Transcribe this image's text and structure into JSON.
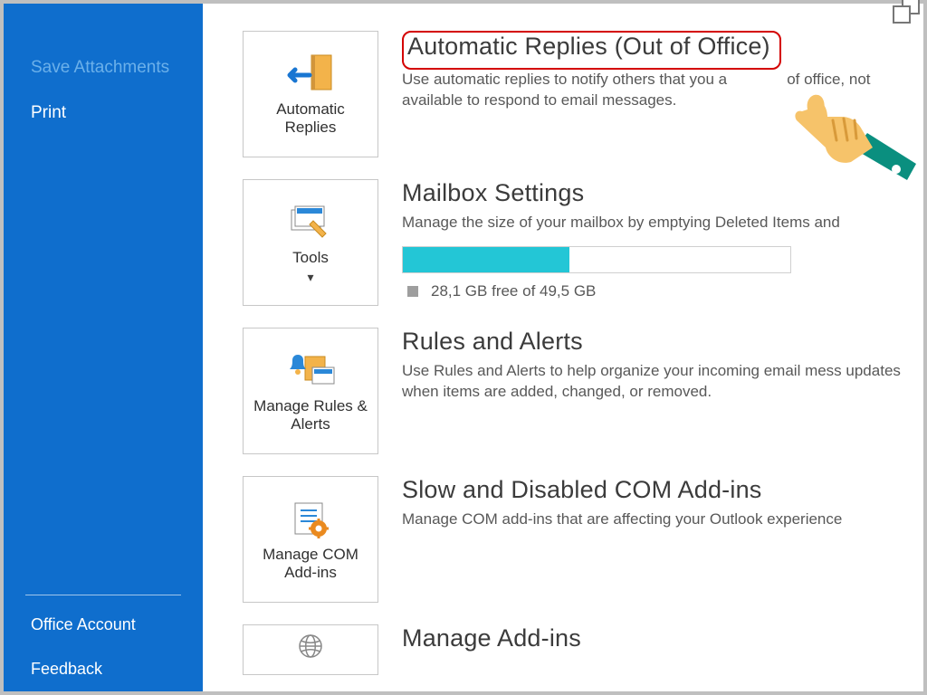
{
  "sidebar": {
    "save_attachments": "Save Attachments",
    "print": "Print",
    "office_account": "Office Account",
    "feedback": "Feedback"
  },
  "tiles": {
    "auto_replies": "Automatic Replies",
    "tools": "Tools",
    "rules": "Manage Rules & Alerts",
    "com": "Manage COM Add-ins"
  },
  "sections": {
    "auto": {
      "title": "Automatic Replies (Out of Office)",
      "desc_a": "Use automatic replies to notify others that you a",
      "desc_b": "of office, not available to respond to email messages."
    },
    "mailbox": {
      "title": "Mailbox Settings",
      "desc": "Manage the size of your mailbox by emptying Deleted Items and",
      "storage": "28,1 GB free of 49,5 GB",
      "fill_percent": 43
    },
    "rules": {
      "title": "Rules and Alerts",
      "desc": "Use Rules and Alerts to help organize your incoming email mess updates when items are added, changed, or removed."
    },
    "slow": {
      "title": "Slow and Disabled COM Add-ins",
      "desc": "Manage COM add-ins that are affecting your Outlook experience"
    },
    "manage": {
      "title": "Manage Add-ins"
    }
  }
}
